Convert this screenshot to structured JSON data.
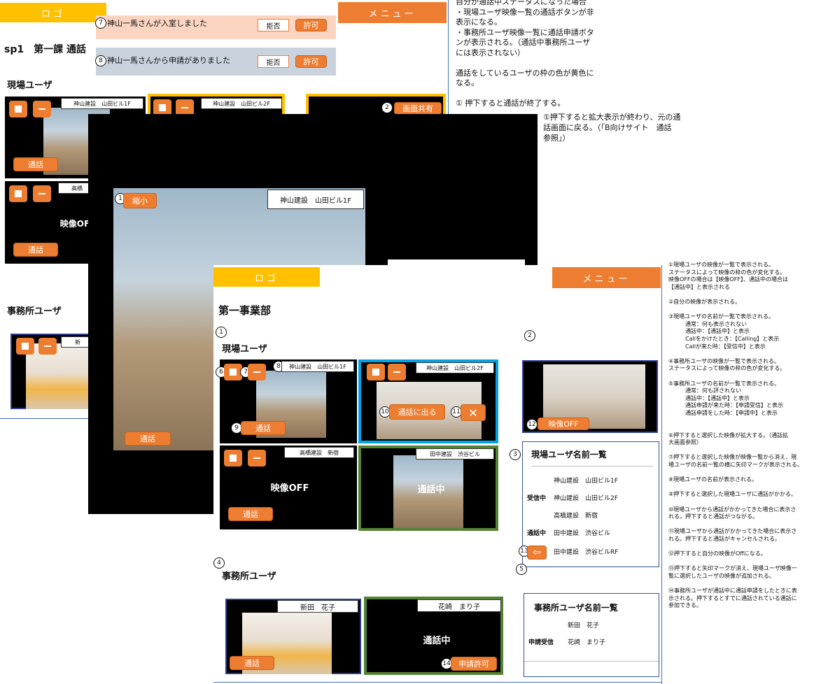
{
  "bg": {
    "logo": "ロゴ",
    "menu": "メニュー",
    "title": "sp1　第一課 通話",
    "field_users": "現場ユーザ",
    "office_users": "事務所ユーザ",
    "tile1_name": "神山建設　山田ビル1F",
    "tile2_name": "神山建設　山田ビル2F",
    "tile4_name": "高橋",
    "call_label": "通話",
    "video_off": "映像OF",
    "screen_share": "画面共有",
    "office_name_partial": "新"
  },
  "notices": [
    {
      "num": "7",
      "text": "神山一馬さんが入室しました",
      "reject": "拒否",
      "accept": "許可"
    },
    {
      "num": "8",
      "text": "神山一馬さんから申請がありました",
      "reject": "拒否",
      "accept": "許可"
    }
  ],
  "top_notes": {
    "lines": [
      "自分が通話中ステータスになった場合",
      "・現場ユーザ映像一覧の通話ボタンが非",
      "表示になる。",
      "・事務所ユーザ映像一覧に通話申請ボタ",
      "ンが表示される。（通話中事務所ユーザ",
      "には表示されない）",
      "",
      "通話をしているユーザの枠の色が黄色に",
      "なる。",
      "",
      "①  押下すると通話が終了する。"
    ],
    "zoom_note": [
      "①押下すると拡大表示が終わり、元の通",
      "話画面に戻る。（「B向けサイト　通話",
      "参照」）"
    ]
  },
  "zoom": {
    "num": "1",
    "shrink": "縮小",
    "name": "神山建設　山田ビル1F",
    "call": "通話"
  },
  "front": {
    "logo": "ロゴ",
    "menu": "メニュー",
    "dept": "第一事業部",
    "field_users": "現場ユーザ",
    "office_users": "事務所ユーザ",
    "tiles": {
      "t1_name": "神山建設　山田ビル1F",
      "t1_call": "通話",
      "t2_name": "神山建設　山田ビル2F",
      "t2_answer": "通話に出る",
      "t2_cancel": "✕",
      "t3_name": "高橋建設　新宿",
      "t3_off": "映像OFF",
      "t3_call": "通話",
      "t4_name": "田中建設　渋谷ビル",
      "t4_busy": "通話中"
    },
    "self_off": "映像OFF",
    "office": {
      "o1_name": "新田　花子",
      "o1_call": "通話",
      "o2_name": "花崎　まり子",
      "o2_busy": "通話中",
      "o2_permit": "申請許可"
    },
    "field_list": {
      "title": "現場ユーザ名前一覧",
      "rows": [
        {
          "status": "",
          "name": "神山建設　山田ビル1F"
        },
        {
          "status": "受信中",
          "name": "神山建設　山田ビル2F"
        },
        {
          "status": "",
          "name": "高橋建設　新宿"
        },
        {
          "status": "通話中",
          "name": "田中建設　渋谷ビル"
        },
        {
          "status": "",
          "name": "田中建設　渋谷ビルRF"
        }
      ]
    },
    "office_list": {
      "title": "事務所ユーザ名前一覧",
      "rows": [
        {
          "status": "",
          "name": "新田　花子"
        },
        {
          "status": "申請受信",
          "name": "花崎　まり子"
        }
      ]
    },
    "markers": {
      "m1": "1",
      "m2": "2",
      "m3": "3",
      "m4": "4",
      "m5": "5",
      "m6": "6",
      "m7": "7",
      "m8": "8",
      "m9": "9",
      "m10": "10",
      "m11": "11",
      "m12": "12",
      "m13": "13",
      "m14": "14"
    }
  },
  "side_notes": [
    "①現場ユーザの映像が一覧で表示される。",
    "ステータスによって映像の枠の色が変化する。",
    "映像OFFの場合は【映像OFF】、通話中の場合は",
    "【通話中】と表示される",
    "",
    "②自分の映像が表示される。",
    "",
    "③現場ユーザの名前が一覧で表示される。",
    "　　　通常：何も表示されない",
    "　　　通話中：【通話中】と表示",
    "　　　Callをかけたとき：【Calling】と表示",
    "　　　Callが来た時：【受信中】と表示",
    "",
    "④事務所ユーザの映像が一覧で表示される。",
    "ステータスによって映像の枠の色が変化する。",
    "",
    "⑤事務所ユーザの名前が一覧で表示される。",
    "　　　通常：何も評されない",
    "　　　通話中：【通話中】と表示",
    "　　　通話申請が来た時：【申請受信】と表示",
    "　　　通話申請をした時：【申請中】と表示",
    "",
    "",
    "⑥押下すると選択した映像が拡大する。（通話拡",
    "大画面参照）",
    "",
    "⑦押下すると選択した映像が映像一覧から消え、現",
    "場ユーザの名前一覧の横に矢印マークが表示される。",
    "",
    "⑧現場ユーザの名前が表示される。",
    "",
    "⑨押下すると選択した現場ユーザに通話がかかる。",
    "",
    "⑩現場ユーザから通話がかかってきた場合に表示さ",
    "れる。押下すると通話がつながる。",
    "",
    "⑪現場ユーザから通話がかかってきた場合に表示さ",
    "れる。押下すると通話がキャンセルされる。",
    "",
    "⑫押下すると自分の映像がOffになる。",
    "",
    "⑬押下すると矢印マークが消え、現場ユーザ映像一",
    "覧に選択したユーザの映像が追加される。",
    "",
    "⑭事務所ユーザが通話中に通話申請をしたときに表",
    "示される。押下するとすでに通話されている通話に",
    "参加できる。"
  ],
  "colors": {
    "accent": "#ed7d31",
    "logo_yellow": "#ffc000",
    "incoming_blue": "#00a2e8",
    "busy_green": "#548235",
    "notice1": "#fbd5c1",
    "notice2": "#c9d2dd"
  }
}
